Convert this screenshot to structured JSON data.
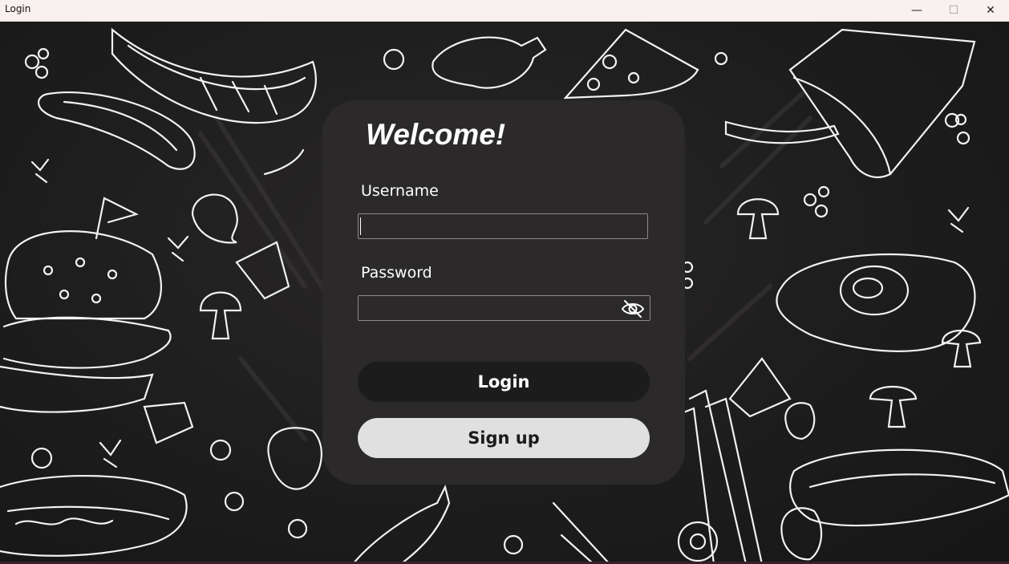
{
  "window": {
    "title": "Login",
    "controls": {
      "minimize": "—",
      "maximize": "☐",
      "close": "✕"
    }
  },
  "form": {
    "heading": "Welcome!",
    "username_label": "Username",
    "username_value": "",
    "password_label": "Password",
    "password_value": "",
    "password_toggle_icon": "eye-off-icon",
    "login_label": "Login",
    "signup_label": "Sign up"
  },
  "colors": {
    "background": "#1b1b1b",
    "card": "#2b2929",
    "login_button": "#1c1c1c",
    "signup_button": "#e0e0e0",
    "titlebar": "#f9f0f0"
  }
}
